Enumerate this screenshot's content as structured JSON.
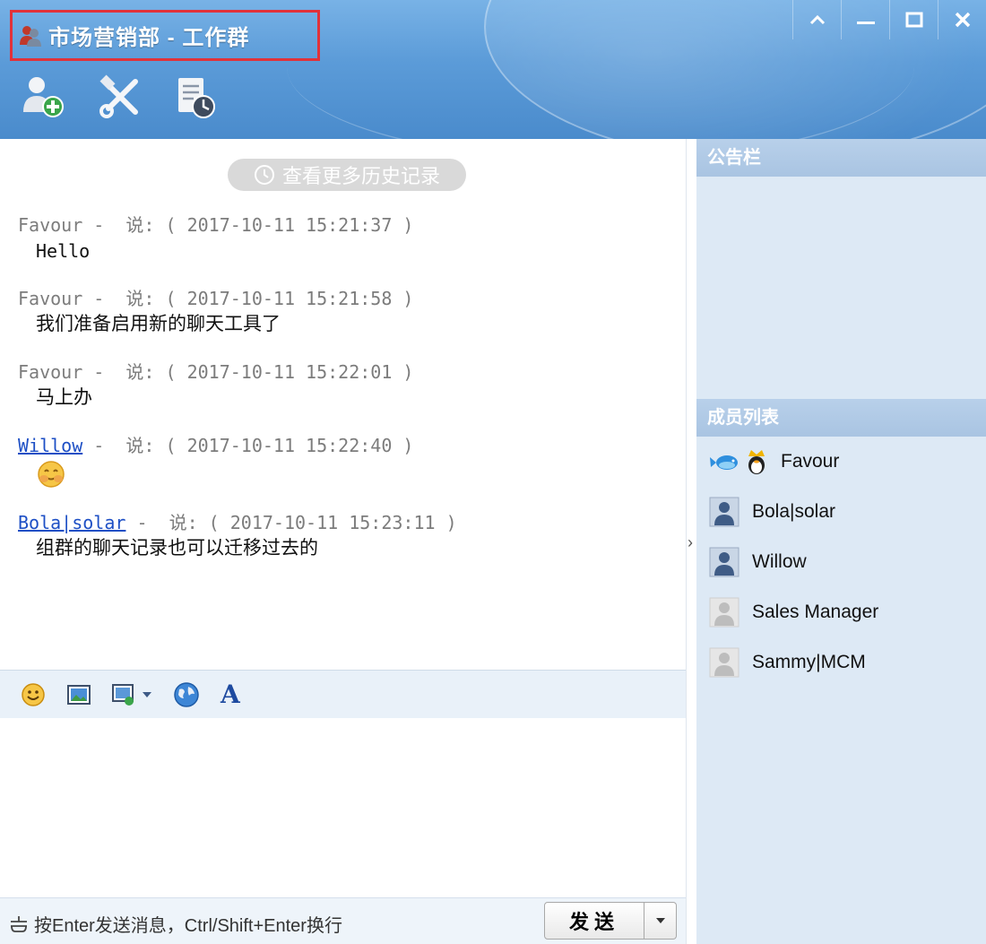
{
  "window": {
    "title": "市场营销部 - 工作群",
    "controls": [
      "collapse-icon",
      "minimize-icon",
      "maximize-icon",
      "close-icon"
    ]
  },
  "toolbar": {
    "icons": [
      "add-member-icon",
      "settings-tools-icon",
      "history-log-icon"
    ]
  },
  "chat": {
    "history_button_label": "查看更多历史记录",
    "messages": [
      {
        "sender": "Favour",
        "linked": false,
        "separator": " -  说: ( 2017-10-11 15:21:37 )",
        "body": "Hello",
        "body_type": "text"
      },
      {
        "sender": "Favour",
        "linked": false,
        "separator": " -  说: ( 2017-10-11 15:21:58 )",
        "body": "我们准备启用新的聊天工具了",
        "body_type": "text"
      },
      {
        "sender": "Favour",
        "linked": false,
        "separator": " -  说: ( 2017-10-11 15:22:01 )",
        "body": "马上办",
        "body_type": "text"
      },
      {
        "sender": "Willow",
        "linked": true,
        "separator": " -  说: ( 2017-10-11 15:22:40 )",
        "body": "smiling-emoji",
        "body_type": "emoji"
      },
      {
        "sender": "Bola|solar",
        "linked": true,
        "separator": " -  说: ( 2017-10-11 15:23:11 )",
        "body": "组群的聊天记录也可以迁移过去的",
        "body_type": "text"
      }
    ]
  },
  "input_toolbar": {
    "icons": [
      "emoji-icon",
      "image-icon",
      "screenshot-icon",
      "globe-icon"
    ],
    "font_button_label": "A"
  },
  "bottom_bar": {
    "hint": "按Enter发送消息，Ctrl/Shift+Enter换行",
    "send_label": "发送"
  },
  "side_panel": {
    "notice_title": "公告栏",
    "members_title": "成员列表",
    "members": [
      {
        "name": "Favour",
        "status": "online-owner"
      },
      {
        "name": "Bola|solar",
        "status": "online"
      },
      {
        "name": "Willow",
        "status": "online"
      },
      {
        "name": "Sales Manager",
        "status": "offline"
      },
      {
        "name": "Sammy|MCM",
        "status": "offline"
      }
    ]
  },
  "colors": {
    "header": "#5b9bd8",
    "title_border": "#e1323a",
    "link": "#1d4fc5",
    "side_panel": "#dde9f5"
  }
}
